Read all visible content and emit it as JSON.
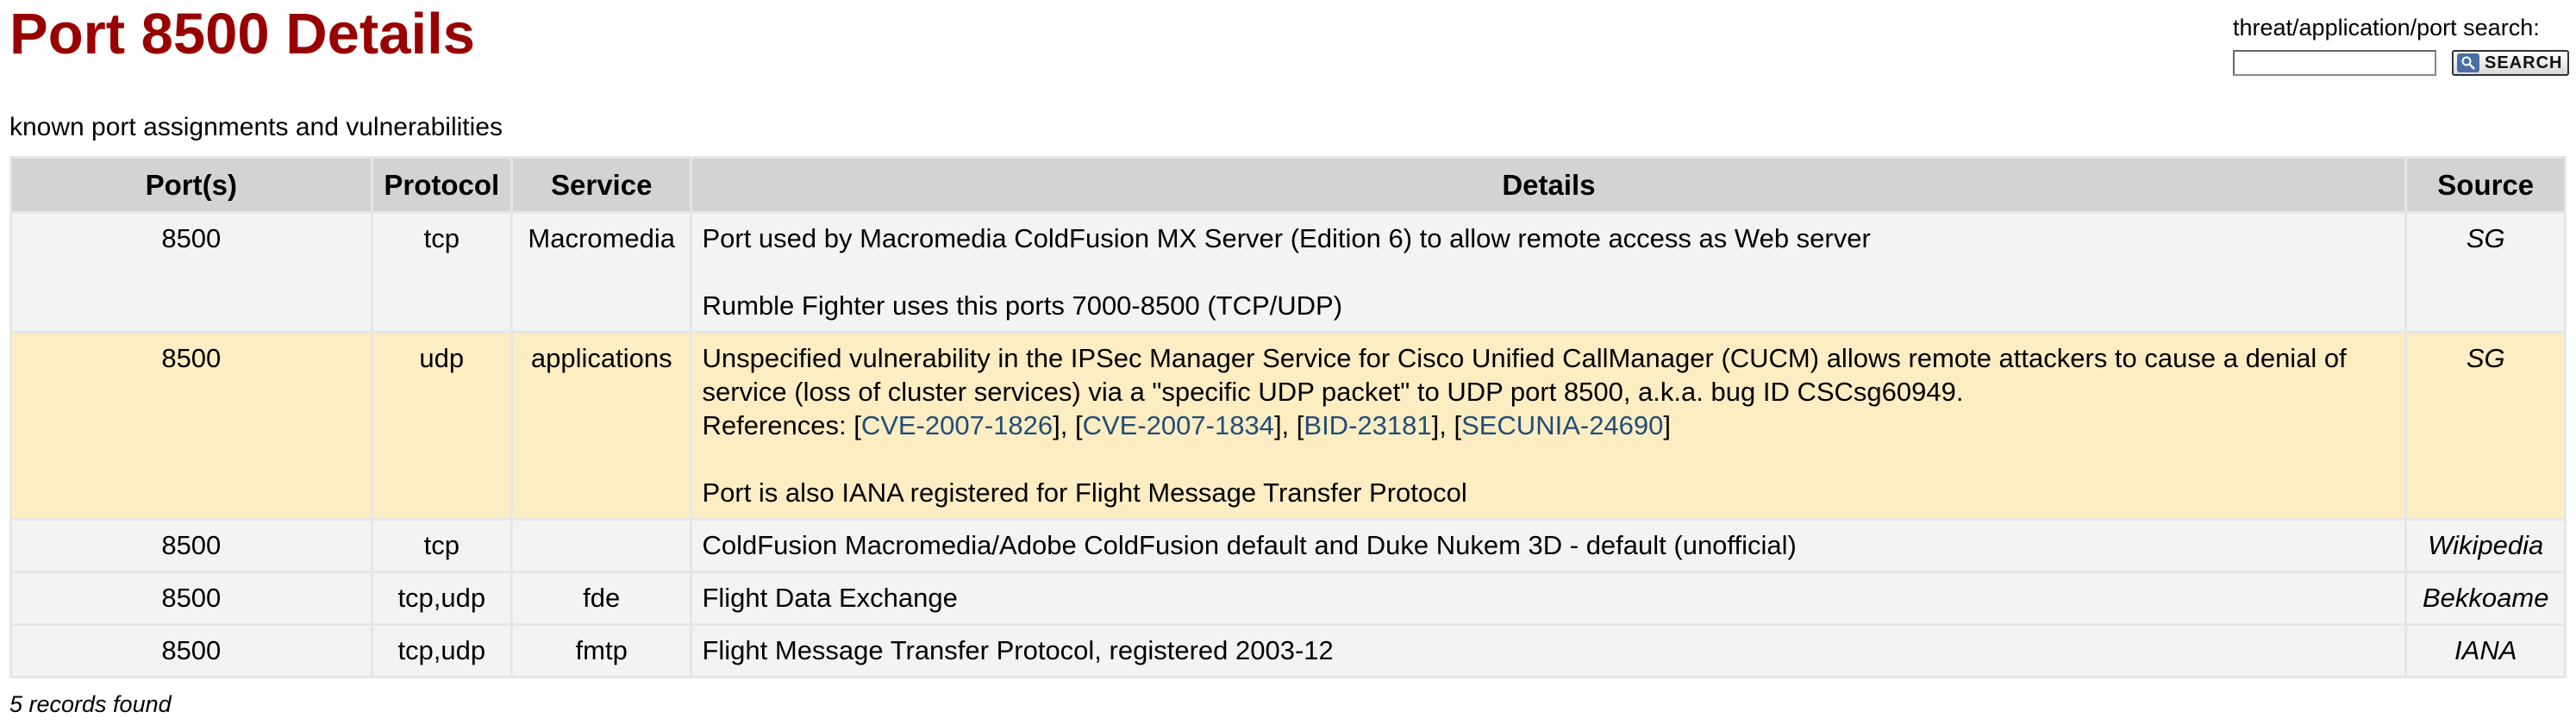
{
  "page": {
    "title": "Port 8500 Details",
    "subtitle": "known port assignments and vulnerabilities",
    "footer": "5 records found"
  },
  "search": {
    "label": "threat/application/port search:",
    "input_value": "",
    "button_label": "SEARCH",
    "icon": "search-icon"
  },
  "table": {
    "headers": [
      "Port(s)",
      "Protocol",
      "Service",
      "Details",
      "Source"
    ],
    "rows": [
      {
        "port": "8500",
        "protocol": "tcp",
        "service": "Macromedia",
        "details_1": "Port used by Macromedia ColdFusion MX Server (Edition 6) to allow remote access as Web server",
        "details_2": "Rumble Fighter uses this ports 7000-8500 (TCP/UDP)",
        "source": "SG"
      },
      {
        "port": "8500",
        "protocol": "udp",
        "service": "applications",
        "details_1": "Unspecified vulnerability in the IPSec Manager Service for Cisco Unified CallManager (CUCM) allows remote attackers to cause a denial of service (loss of cluster services) via a \"specific UDP packet\" to UDP port 8500, a.k.a. bug ID CSCsg60949.",
        "references_label": "References: [",
        "references": [
          "CVE-2007-1826",
          "CVE-2007-1834",
          "BID-23181",
          "SECUNIA-24690"
        ],
        "details_2": "Port is also IANA registered for Flight Message Transfer Protocol",
        "source": "SG"
      },
      {
        "port": "8500",
        "protocol": "tcp",
        "service": "",
        "details_1": "ColdFusion Macromedia/Adobe ColdFusion default and Duke Nukem 3D - default (unofficial)",
        "source": "Wikipedia"
      },
      {
        "port": "8500",
        "protocol": "tcp,udp",
        "service": "fde",
        "details_1": "Flight Data Exchange",
        "source": "Bekkoame"
      },
      {
        "port": "8500",
        "protocol": "tcp,udp",
        "service": "fmtp",
        "details_1": "Flight Message Transfer Protocol, registered 2003-12",
        "source": "IANA"
      }
    ]
  },
  "colors": {
    "title": "#990000",
    "header_bg": "#d3d3d3",
    "row_bg": "#f3f3f3",
    "highlight_row_bg": "#fdedc3",
    "link": "#1f4d7a"
  }
}
